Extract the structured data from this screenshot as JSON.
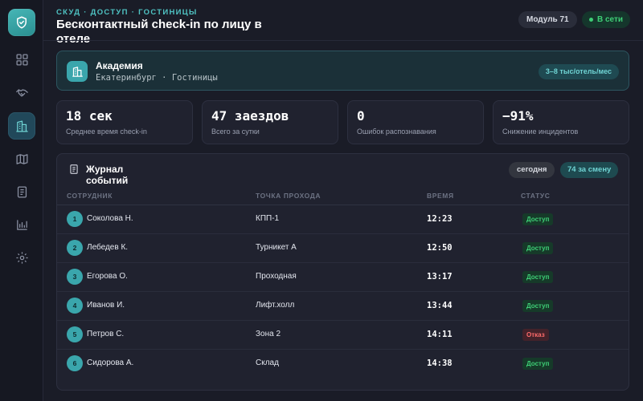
{
  "header": {
    "breadcrumb": "СКУД · ДОСТУП · ГОСТИНИЦЫ",
    "title": "Бесконтактный check-in по лицу в отеле",
    "module_chip": "Модуль 71",
    "status_chip": "В сети"
  },
  "org": {
    "name": "Академия",
    "subtitle": "Екатеринбург · Гостиницы",
    "price": "3–8 тыс/отель/мес"
  },
  "stats": [
    {
      "value": "18 сек",
      "label": "Среднее время check-in"
    },
    {
      "value": "47 заездов",
      "label": "Всего за сутки"
    },
    {
      "value": "0",
      "label": "Ошибок распознавания"
    },
    {
      "value": "−91%",
      "label": "Снижение инцидентов"
    }
  ],
  "log": {
    "title": "Журнал событий",
    "filter_label": "сегодня",
    "count_label": "74 за смену",
    "columns": [
      "СОТРУДНИК",
      "ТОЧКА ПРОХОДА",
      "ВРЕМЯ",
      "СТАТУС"
    ],
    "rows": [
      {
        "num": "1",
        "employee": "Соколова Н.",
        "point": "КПП-1",
        "time": "12:23",
        "status": "Доступ"
      },
      {
        "num": "2",
        "employee": "Лебедев К.",
        "point": "Турникет А",
        "time": "12:50",
        "status": "Доступ"
      },
      {
        "num": "3",
        "employee": "Егорова О.",
        "point": "Проходная",
        "time": "13:17",
        "status": "Доступ"
      },
      {
        "num": "4",
        "employee": "Иванов И.",
        "point": "Лифт.холл",
        "time": "13:44",
        "status": "Доступ"
      },
      {
        "num": "5",
        "employee": "Петров С.",
        "point": "Зона 2",
        "time": "14:11",
        "status": "Отказ"
      },
      {
        "num": "6",
        "employee": "Сидорова А.",
        "point": "Склад",
        "time": "14:38",
        "status": "Доступ"
      }
    ]
  },
  "colors": {
    "accent": "#4fc3c3",
    "success": "#3ecf76",
    "danger": "#ff6b6b"
  },
  "icons": {
    "logo": "shield-check-icon",
    "nav": [
      "dashboard-icon",
      "handshake-icon",
      "building-icon",
      "map-icon",
      "document-icon",
      "bar-chart-icon",
      "gear-icon"
    ],
    "org": "building-icon",
    "log": "document-icon"
  }
}
